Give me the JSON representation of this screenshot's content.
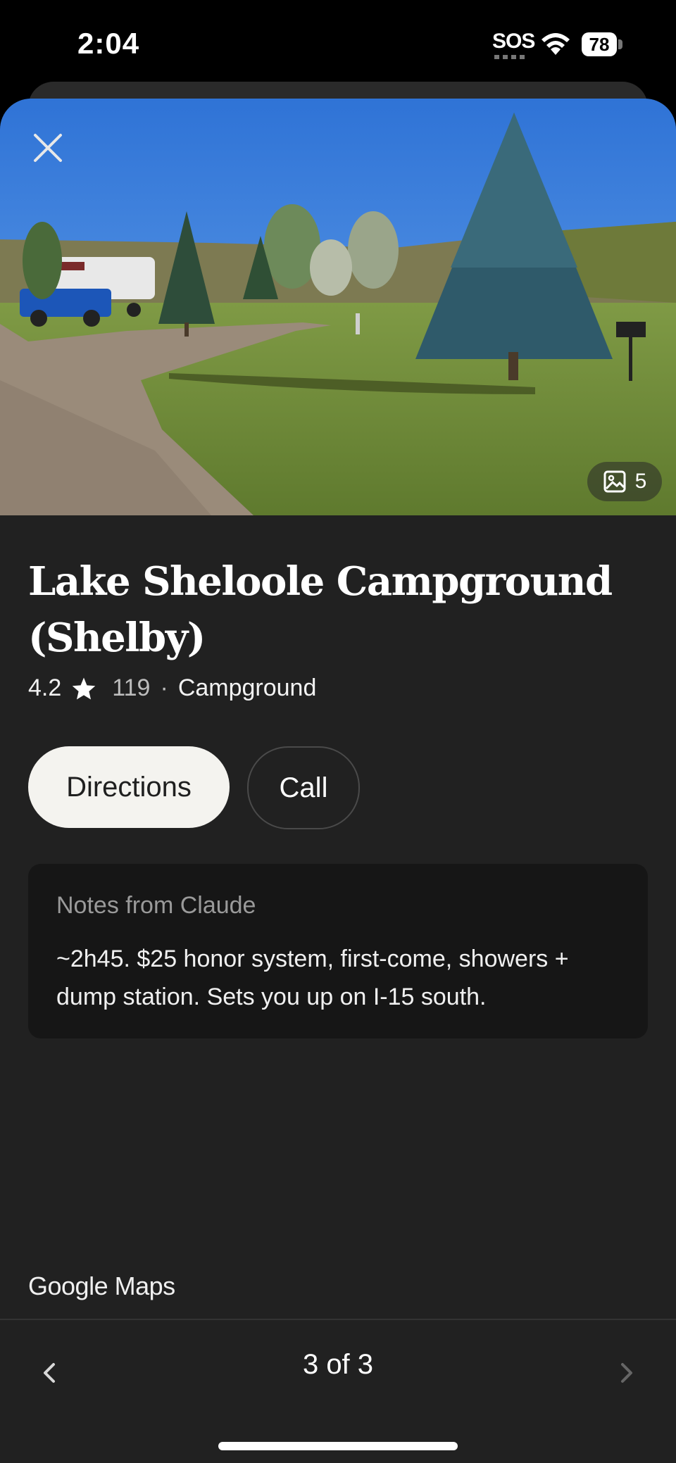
{
  "status_bar": {
    "time": "2:04",
    "sos": "SOS",
    "battery": "78"
  },
  "place": {
    "photo_count": "5",
    "title": "Lake Sheloole Campground (Shelby)",
    "rating": "4.2",
    "review_count": "119",
    "separator": "·",
    "category": "Campground"
  },
  "actions": {
    "directions": "Directions",
    "call": "Call"
  },
  "notes": {
    "label": "Notes from Claude",
    "body": "~2h45. $25 honor system, first-come, showers + dump station. Sets you up on I-15 south."
  },
  "footer": {
    "brand_google": "Google",
    "brand_maps": "Maps"
  },
  "pager": {
    "text": "3 of 3"
  },
  "icons": [
    "close-icon",
    "photos-icon",
    "star-icon",
    "chevron-left-icon",
    "chevron-right-icon",
    "wifi-icon",
    "battery-icon"
  ]
}
